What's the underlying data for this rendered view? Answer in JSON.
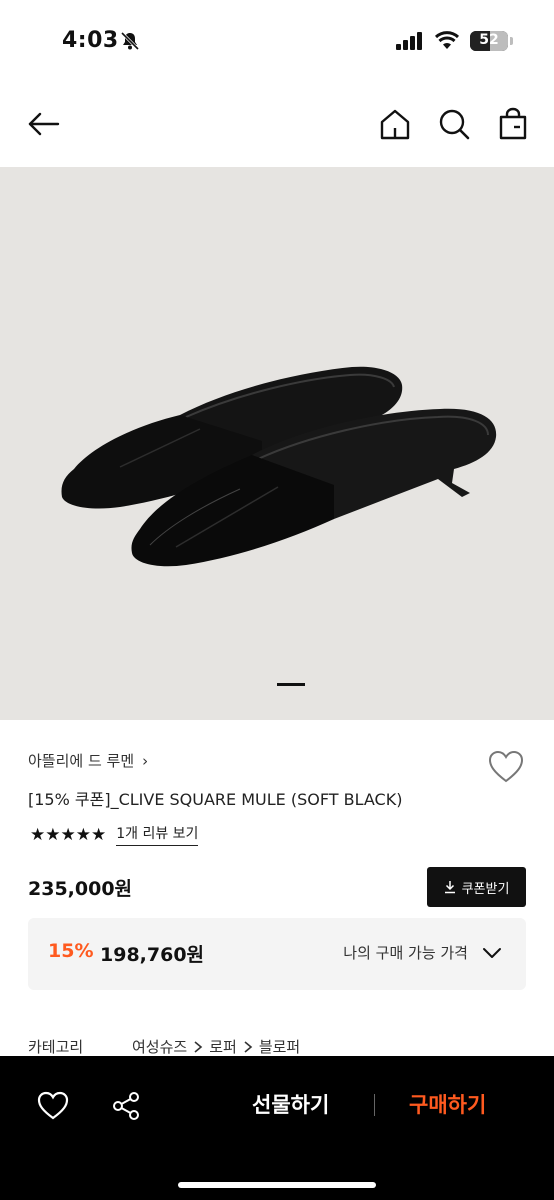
{
  "status_bar": {
    "time": "4:03",
    "battery": "52",
    "battery_level": 0.52
  },
  "header": {
    "back_icon": "arrow-left-icon",
    "home_icon": "home-icon",
    "search_icon": "search-icon",
    "bag_icon": "shopping-bag-icon"
  },
  "product": {
    "image_icon": "product-photo",
    "slide_count": 1,
    "brand": "아뜰리에 드 루멘",
    "brand_chevron": "›",
    "name": "[15% 쿠폰]_CLIVE SQUARE MULE (SOFT BLACK)",
    "rating": 5,
    "stars": "★★★★★",
    "review_link": "1개 리뷰 보기",
    "price": "235,000원",
    "coupon_button": "쿠폰받기"
  },
  "discount": {
    "rate": "15%",
    "price": "198,760원",
    "my_price_label": "나의 구매 가능 가격"
  },
  "category": {
    "label": "카테고리",
    "path": [
      "여성슈즈",
      "로퍼",
      "블로퍼"
    ]
  },
  "bottom_bar": {
    "gift_label": "선물하기",
    "buy_label": "구매하기"
  },
  "colors": {
    "accent": "#ff5a1f",
    "dark": "#111111",
    "image_bg": "#e6e4e1"
  }
}
